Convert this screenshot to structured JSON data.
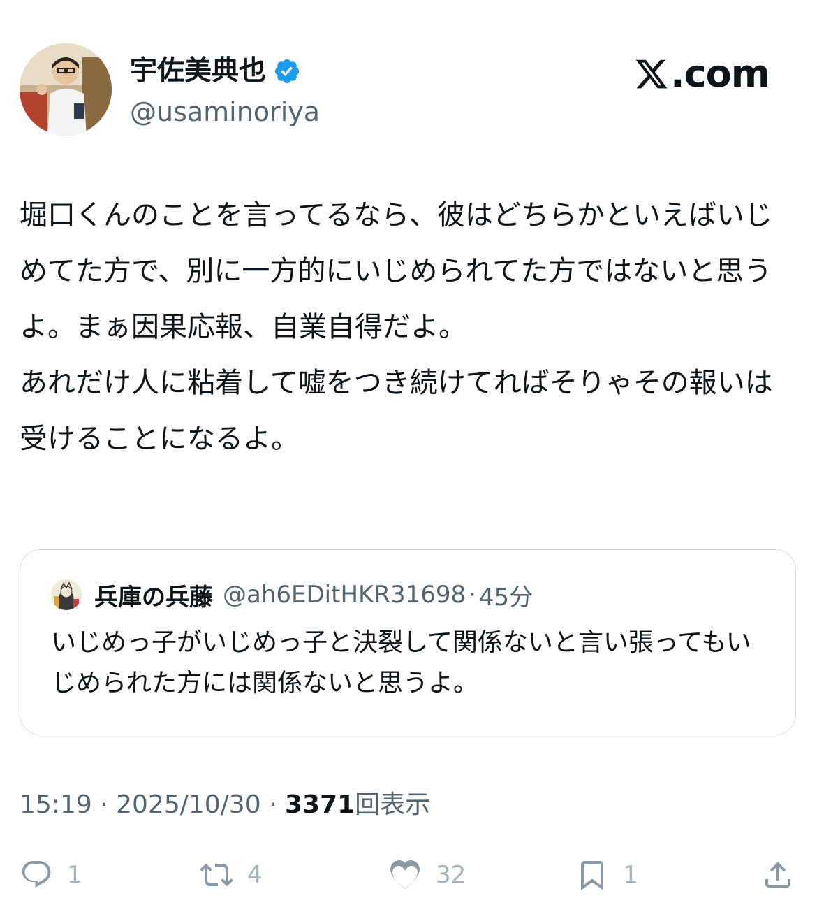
{
  "author": {
    "display_name": "宇佐美典也",
    "handle": "@usaminoriya",
    "verified": true,
    "avatar_icon": "profile-photo"
  },
  "brand": {
    "logo_icon": "x-logo-icon",
    "text": ".com"
  },
  "tweet": {
    "text": "堀口くんのことを言ってるなら、彼はどちらかといえばいじめてた方で、別に一方的にいじめられてた方ではないと思うよ。まぁ因果応報、自業自得だよ。\nあれだけ人に粘着して嘘をつき続けてればそりゃその報いは受けることになるよ。"
  },
  "quote": {
    "display_name": "兵庫の兵藤",
    "handle": "@ah6EDitHKR31698",
    "separator": "·",
    "time": "45分",
    "text": "いじめっ子がいじめっ子と決裂して関係ないと言い張ってもいじめられた方には関係ないと思うよ。"
  },
  "meta": {
    "time": "15:19",
    "sep1": "·",
    "date": "2025/10/30",
    "sep2": "·",
    "views_count": "3371",
    "views_label": "回表示"
  },
  "actions": {
    "reply": {
      "icon": "reply-icon",
      "count": "1"
    },
    "retweet": {
      "icon": "retweet-icon",
      "count": "4"
    },
    "like": {
      "icon": "heart-icon",
      "count": "32"
    },
    "bookmark": {
      "icon": "bookmark-icon",
      "count": "1"
    },
    "share": {
      "icon": "share-icon"
    }
  },
  "colors": {
    "verified_blue": "#1d9bf0",
    "secondary_text": "#536471",
    "border": "#d6dde3"
  }
}
